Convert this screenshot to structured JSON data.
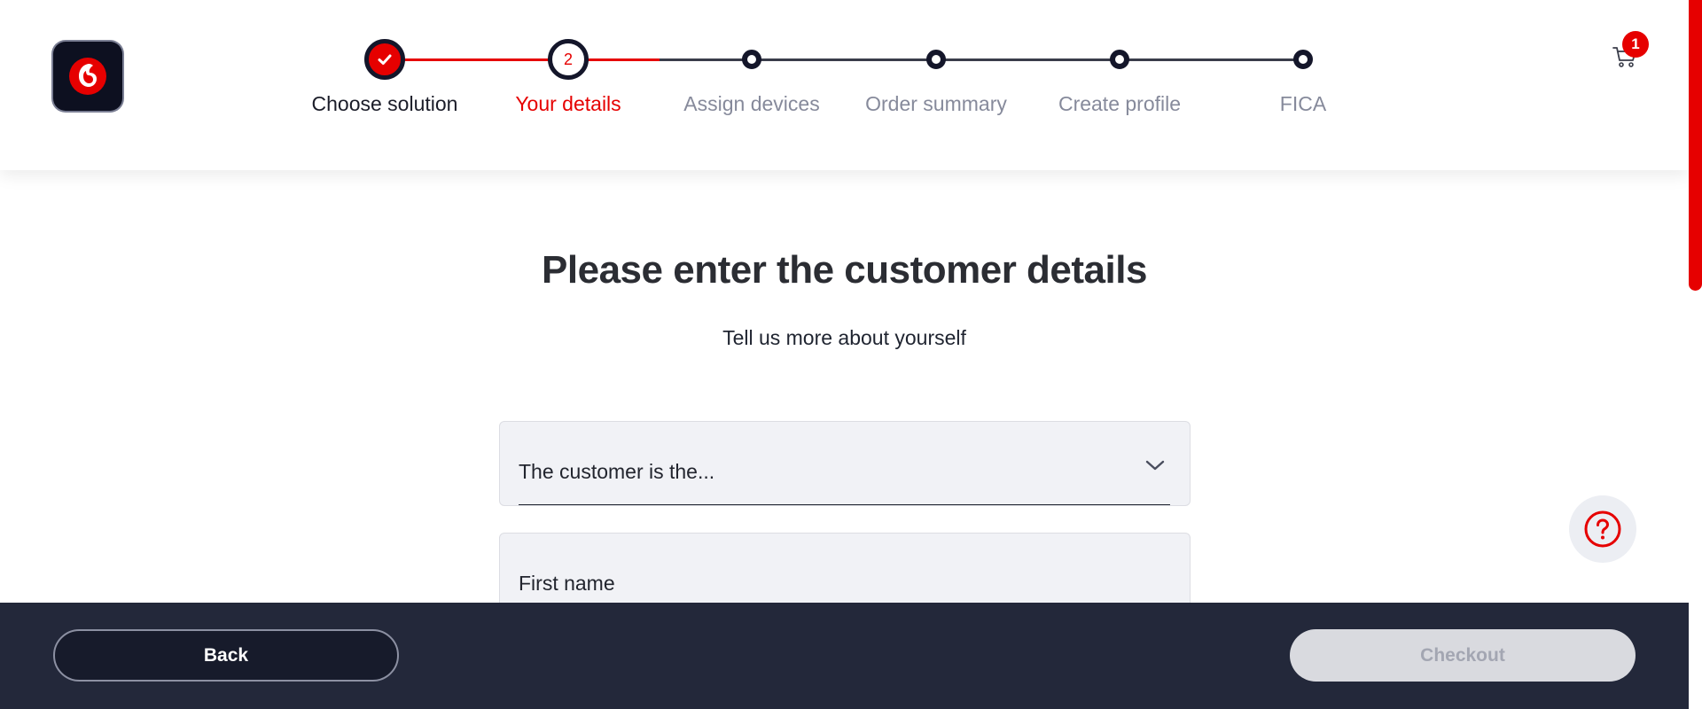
{
  "brand": {
    "logo_icon": "vodafone-speechmark-icon",
    "accent_color": "#e60000",
    "dark_color": "#14162a"
  },
  "stepper": {
    "steps": [
      {
        "label": "Choose solution",
        "state": "done",
        "icon": "check-icon"
      },
      {
        "label": "Your details",
        "state": "current",
        "number": "2"
      },
      {
        "label": "Assign devices",
        "state": "upcoming"
      },
      {
        "label": "Order summary",
        "state": "upcoming"
      },
      {
        "label": "Create profile",
        "state": "upcoming"
      },
      {
        "label": "FICA",
        "state": "upcoming"
      }
    ]
  },
  "cart": {
    "icon": "cart-icon",
    "count": "1"
  },
  "main": {
    "title": "Please enter the customer details",
    "subtitle": "Tell us more about yourself",
    "customer_type_select": {
      "placeholder": "The customer is the...",
      "icon": "chevron-down-icon"
    },
    "first_name_field": {
      "label": "First name"
    }
  },
  "help": {
    "icon": "help-question-icon"
  },
  "footer": {
    "back_label": "Back",
    "checkout_label": "Checkout"
  }
}
